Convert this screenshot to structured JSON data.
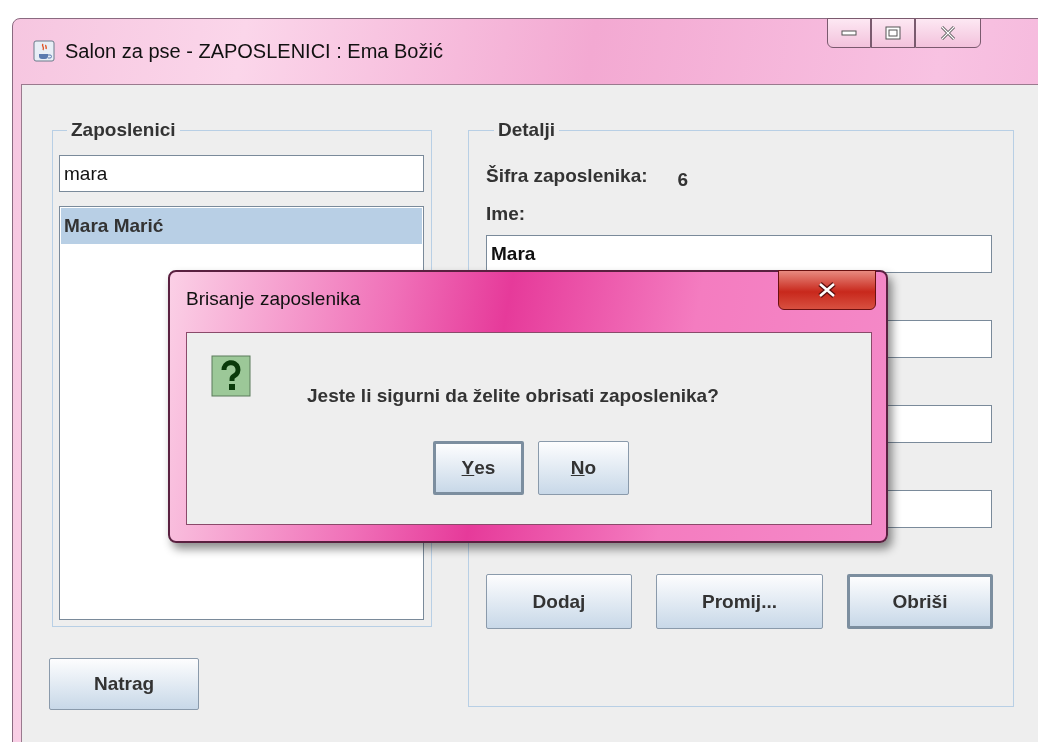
{
  "window": {
    "title": "Salon za pse - ZAPOSLENICI : Ema Božić"
  },
  "employees_group": {
    "title": "Zaposlenici",
    "search": {
      "value": "mara"
    },
    "list": [
      {
        "label": "Mara Marić",
        "selected": true
      }
    ]
  },
  "back_button": {
    "label": "Natrag"
  },
  "details_group": {
    "title": "Detalji",
    "id_label": "Šifra zaposlenika:",
    "id_value": "6",
    "name_label": "Ime:",
    "name_field": {
      "value": "Mara"
    },
    "buttons": [
      {
        "label": "Dodaj",
        "focused": false
      },
      {
        "label": "Promij...",
        "focused": false
      },
      {
        "label": "Obriši",
        "focused": true
      }
    ]
  },
  "dialog": {
    "title": "Brisanje zaposlenika",
    "message": "Jeste li sigurni da želite obrisati zaposlenika?",
    "buttons": [
      {
        "label": "Yes",
        "mnemonic": true,
        "focused": true
      },
      {
        "label": "No",
        "mnemonic": true,
        "focused": false
      }
    ]
  }
}
